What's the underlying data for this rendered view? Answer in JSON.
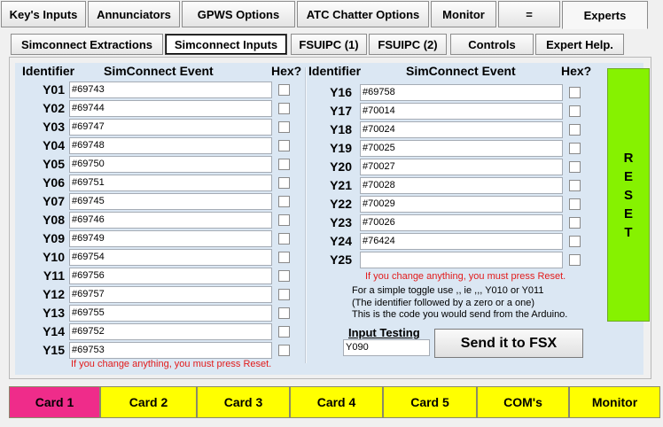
{
  "topbar": {
    "buttons": [
      {
        "label": "Key's Inputs"
      },
      {
        "label": "Annunciators"
      },
      {
        "label": "GPWS  Options"
      },
      {
        "label": "ATC Chatter Options"
      },
      {
        "label": "Monitor"
      },
      {
        "label": "="
      },
      {
        "label": "Experts"
      }
    ]
  },
  "tabs": [
    {
      "label": "Simconnect Extractions"
    },
    {
      "label": "Simconnect Inputs"
    },
    {
      "label": "FSUIPC (1)"
    },
    {
      "label": "FSUIPC (2)"
    },
    {
      "label": "Controls"
    },
    {
      "label": "Expert Help."
    }
  ],
  "left": {
    "header_identifier": "Identifier",
    "header_event": "SimConnect Event",
    "header_hex": "Hex?",
    "rows": [
      {
        "id": "Y01",
        "value": "#69743"
      },
      {
        "id": "Y02",
        "value": "#69744"
      },
      {
        "id": "Y03",
        "value": "#69747"
      },
      {
        "id": "Y04",
        "value": "#69748"
      },
      {
        "id": "Y05",
        "value": "#69750"
      },
      {
        "id": "Y06",
        "value": "#69751"
      },
      {
        "id": "Y07",
        "value": "#69745"
      },
      {
        "id": "Y08",
        "value": "#69746"
      },
      {
        "id": "Y09",
        "value": "#69749"
      },
      {
        "id": "Y10",
        "value": "#69754"
      },
      {
        "id": "Y11",
        "value": "#69756"
      },
      {
        "id": "Y12",
        "value": "#69757"
      },
      {
        "id": "Y13",
        "value": "#69755"
      },
      {
        "id": "Y14",
        "value": "#69752"
      },
      {
        "id": "Y15",
        "value": "#69753"
      }
    ],
    "warning": "If you change anything, you must press Reset."
  },
  "right": {
    "header_identifier": "Identifier",
    "header_event": "SimConnect Event",
    "header_hex": "Hex?",
    "rows": [
      {
        "id": "Y16",
        "value": "#69758"
      },
      {
        "id": "Y17",
        "value": "#70014"
      },
      {
        "id": "Y18",
        "value": "#70024"
      },
      {
        "id": "Y19",
        "value": "#70025"
      },
      {
        "id": "Y20",
        "value": "#70027"
      },
      {
        "id": "Y21",
        "value": "#70028"
      },
      {
        "id": "Y22",
        "value": "#70029"
      },
      {
        "id": "Y23",
        "value": "#70026"
      },
      {
        "id": "Y24",
        "value": "#76424"
      },
      {
        "id": "Y25",
        "value": ""
      }
    ],
    "warning": "If you change anything, you must press Reset.",
    "notes": [
      "For a simple toggle use ,, ie ,,, Y010 or Y011",
      "(The identifier followed by a zero or a one)",
      "This is the code you would send from the Arduino."
    ]
  },
  "reset": {
    "letters": [
      "R",
      "E",
      "S",
      "E",
      "T"
    ]
  },
  "input_testing": {
    "label": "Input Testing",
    "value": "Y090",
    "send_label": "Send it to FSX"
  },
  "cards": [
    {
      "label": "Card 1"
    },
    {
      "label": "Card 2"
    },
    {
      "label": "Card 3"
    },
    {
      "label": "Card 4"
    },
    {
      "label": "Card 5"
    },
    {
      "label": "COM's"
    },
    {
      "label": "Monitor"
    }
  ],
  "colors": {
    "panel": "#dbe7f3",
    "reset": "#86f200",
    "card": "#ffff00",
    "card_active": "#ef2c8a",
    "warning": "#e21b1b"
  }
}
